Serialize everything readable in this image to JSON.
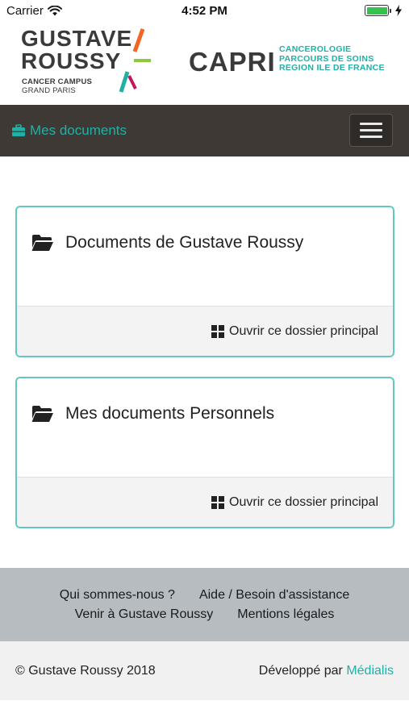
{
  "status_bar": {
    "carrier": "Carrier",
    "time": "4:52 PM",
    "battery_level": 1.0,
    "icons": [
      "wifi-icon",
      "battery-icon",
      "charging-bolt-icon"
    ]
  },
  "header": {
    "logo": {
      "line1": "GUSTAVE",
      "line2": "ROUSSY",
      "sub1": "CANCER CAMPUS",
      "sub2": "GRAND PARIS"
    },
    "capri": {
      "title": "CAPRI",
      "tag1": "CANCEROLOGIE",
      "tag2": "PARCOURS DE SOINS",
      "tag3": "REGION ILE DE FRANCE"
    }
  },
  "navbar": {
    "brand_label": "Mes documents",
    "brand_icon": "briefcase-icon",
    "menu_icon": "hamburger-icon"
  },
  "cards": [
    {
      "title": "Documents de Gustave Roussy",
      "icon": "folder-open-icon",
      "action_label": "Ouvrir ce dossier principal",
      "action_icon": "grid-icon"
    },
    {
      "title": "Mes documents Personnels",
      "icon": "folder-open-icon",
      "action_label": "Ouvrir ce dossier principal",
      "action_icon": "grid-icon"
    }
  ],
  "footer": {
    "links": {
      "about": "Qui sommes-nous ?",
      "help": "Aide / Besoin d'assistance",
      "directions": "Venir à Gustave Roussy",
      "legal": "Mentions légales"
    },
    "copyright": "© Gustave Roussy 2018",
    "developed_by": "Développé par",
    "developer": "Médialis"
  },
  "colors": {
    "accent": "#1fb1a6",
    "navbar_bg": "#3e3935",
    "card_border": "#63c9bf",
    "footer_links_bg": "#b7bcc0",
    "footer_bottom_bg": "#f1f1f1",
    "logo_orange": "#f26522",
    "logo_green": "#8dc63f",
    "logo_teal": "#1fb1a6",
    "logo_magenta": "#c2185b"
  }
}
